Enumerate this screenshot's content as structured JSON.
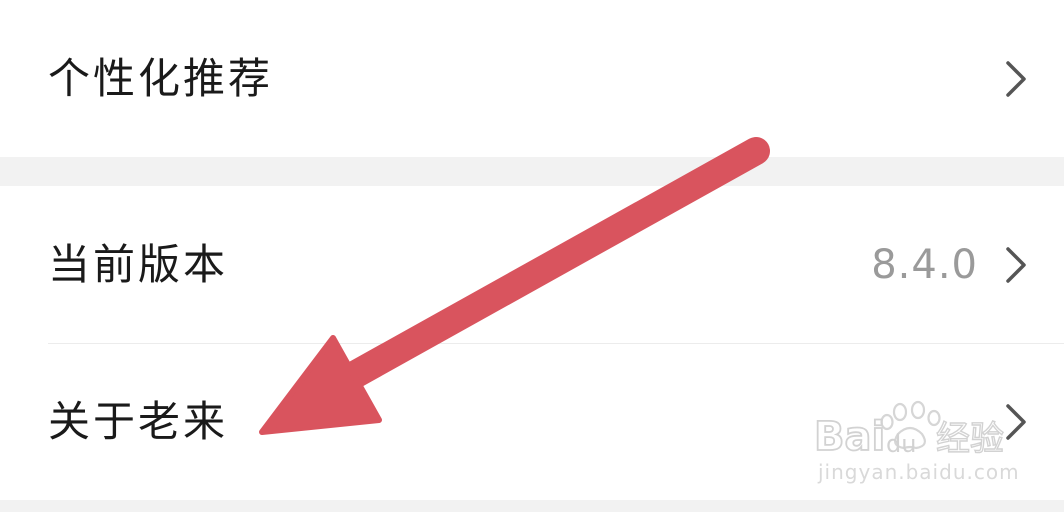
{
  "settings": {
    "items": [
      {
        "label": "个性化推荐",
        "value": ""
      },
      {
        "label": "当前版本",
        "value": "8.4.0"
      },
      {
        "label": "关于老来",
        "value": ""
      }
    ]
  },
  "watermark": {
    "logo_text": "Baidu经验",
    "url": "jingyan.baidu.com"
  },
  "colors": {
    "background": "#f2f2f2",
    "row_background": "#ffffff",
    "label_text": "#1a1a1a",
    "value_text": "#9a9a9a",
    "chevron": "#555555",
    "annotation_arrow": "#d9545e"
  },
  "icons": {
    "chevron": "chevron-right-icon",
    "annotation": "red-arrow-icon"
  }
}
